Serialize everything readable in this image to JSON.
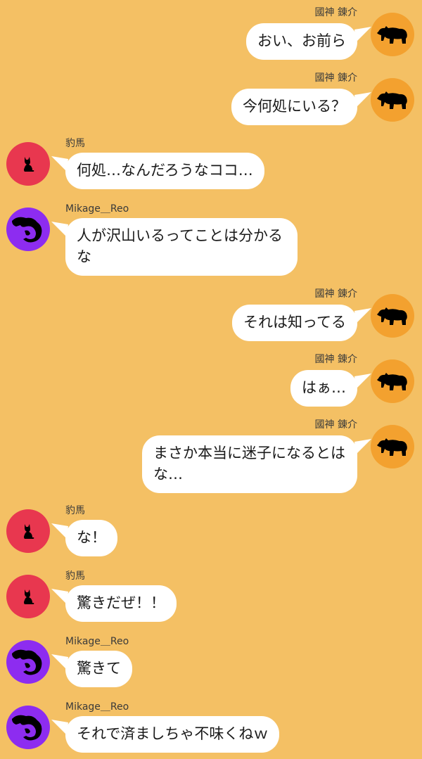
{
  "users": {
    "renske": "國神 錬介",
    "chigiri": "豹馬",
    "reo": "Mikage＿Reo"
  },
  "messages": [
    {
      "side": "right",
      "user": "國神 錬介",
      "avatar": "bear-icon",
      "text": "おい、お前ら"
    },
    {
      "side": "right",
      "user": "國神 錬介",
      "avatar": "bear-icon",
      "text": "今何処にいる？"
    },
    {
      "side": "left",
      "user": "豹馬",
      "avatar": "cat-icon",
      "text": "何処…なんだろうなココ…"
    },
    {
      "side": "left",
      "user": "Mikage＿Reo",
      "avatar": "dragon-icon",
      "text": "人が沢山いるってことは分かるな"
    },
    {
      "side": "right",
      "user": "國神 錬介",
      "avatar": "bear-icon",
      "text": "それは知ってる"
    },
    {
      "side": "right",
      "user": "國神 錬介",
      "avatar": "bear-icon",
      "text": "はぁ…"
    },
    {
      "side": "right",
      "user": "國神 錬介",
      "avatar": "bear-icon",
      "text": "まさか本当に迷子になるとはな…"
    },
    {
      "side": "left",
      "user": "豹馬",
      "avatar": "cat-icon",
      "text": "な！"
    },
    {
      "side": "left",
      "user": "豹馬",
      "avatar": "cat-icon",
      "text": "驚きだぜ！！"
    },
    {
      "side": "left",
      "user": "Mikage＿Reo",
      "avatar": "dragon-icon",
      "text": "驚きて"
    },
    {
      "side": "left",
      "user": "Mikage＿Reo",
      "avatar": "dragon-icon",
      "text": "それで済ましちゃ不味くねｗ"
    }
  ],
  "colors": {
    "background": "#f4c064",
    "bubble": "#ffffff",
    "bear_avatar": "#f3a12f",
    "cat_avatar": "#e8374f",
    "dragon_avatar": "#8d2cf0"
  }
}
